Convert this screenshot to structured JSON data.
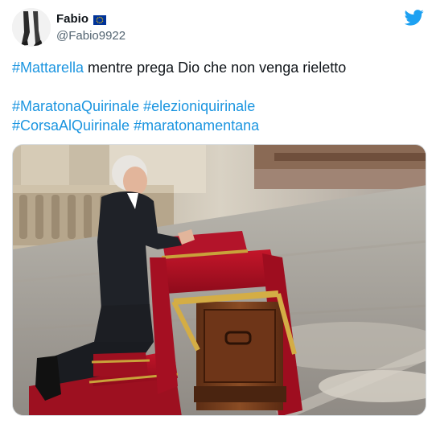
{
  "tweet": {
    "display_name": "Fabio",
    "name_badge_icon": "eu-flag-icon",
    "handle": "@Fabio9922",
    "platform_icon": "twitter-bird-icon",
    "brand_color": "#1da1f2",
    "hashtag_color": "#1b95e0",
    "text": {
      "line1": {
        "hashtag": "#Mattarella",
        "rest": " mentre prega Dio che non venga rieletto"
      },
      "hashtags_line2": [
        "#MaratonaQuirinale",
        "#elezioniquirinale"
      ],
      "hashtags_line3": [
        "#CorsaAlQuirinale",
        "#maratonamentana"
      ]
    },
    "media": {
      "type": "photo"
    }
  }
}
